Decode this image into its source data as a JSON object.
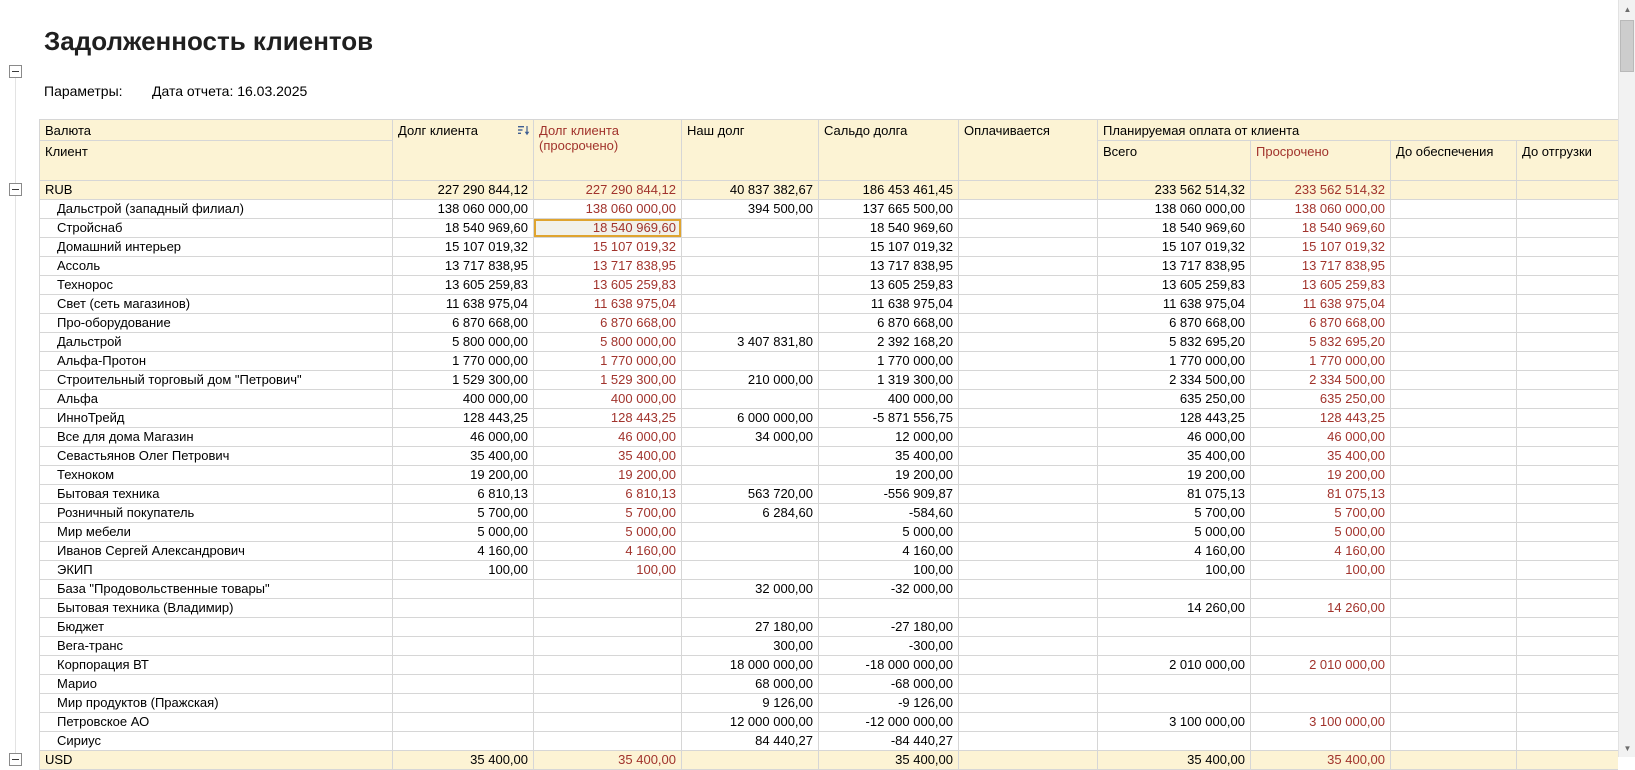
{
  "report": {
    "title": "Задолженность клиентов",
    "params_label": "Параметры:",
    "params_value": "Дата отчета: 16.03.2025"
  },
  "colors": {
    "overdue_text": "#a1332c",
    "header_bg": "#fcf3d4",
    "selection_border": "#dfa42f"
  },
  "icons": {
    "sort": "sort-descending-icon",
    "collapse": "collapse-minus-icon",
    "scroll_up": "▲",
    "scroll_down": "▼"
  },
  "table": {
    "headers": {
      "currency": "Валюта",
      "client": "Клиент",
      "client_debt": "Долг клиента",
      "client_debt_overdue": "Долг клиента (просрочено)",
      "our_debt": "Наш долг",
      "debt_balance": "Сальдо долга",
      "being_paid": "Оплачивается",
      "planned_payment": "Планируемая оплата от клиента",
      "total": "Всего",
      "overdue": "Просрочено",
      "before_security": "До обеспечения",
      "before_shipment": "До отгрузки"
    },
    "rows": [
      {
        "name": "RUB",
        "group": true,
        "cells": [
          "227 290 844,12",
          "227 290 844,12",
          "40 837 382,67",
          "186 453 461,45",
          "",
          "233 562 514,32",
          "233 562 514,32",
          "",
          ""
        ]
      },
      {
        "name": "Дальстрой (западный филиал)",
        "cells": [
          "138 060 000,00",
          "138 060 000,00",
          "394 500,00",
          "137 665 500,00",
          "",
          "138 060 000,00",
          "138 060 000,00",
          "",
          ""
        ]
      },
      {
        "name": "Стройснаб",
        "selected_cell": 1,
        "cells": [
          "18 540 969,60",
          "18 540 969,60",
          "",
          "18 540 969,60",
          "",
          "18 540 969,60",
          "18 540 969,60",
          "",
          ""
        ]
      },
      {
        "name": "Домашний интерьер",
        "cells": [
          "15 107 019,32",
          "15 107 019,32",
          "",
          "15 107 019,32",
          "",
          "15 107 019,32",
          "15 107 019,32",
          "",
          ""
        ]
      },
      {
        "name": "Ассоль",
        "cells": [
          "13 717 838,95",
          "13 717 838,95",
          "",
          "13 717 838,95",
          "",
          "13 717 838,95",
          "13 717 838,95",
          "",
          ""
        ]
      },
      {
        "name": "Технорос",
        "cells": [
          "13 605 259,83",
          "13 605 259,83",
          "",
          "13 605 259,83",
          "",
          "13 605 259,83",
          "13 605 259,83",
          "",
          ""
        ]
      },
      {
        "name": "Свет (сеть магазинов)",
        "cells": [
          "11 638 975,04",
          "11 638 975,04",
          "",
          "11 638 975,04",
          "",
          "11 638 975,04",
          "11 638 975,04",
          "",
          ""
        ]
      },
      {
        "name": "Про-оборудование",
        "cells": [
          "6 870 668,00",
          "6 870 668,00",
          "",
          "6 870 668,00",
          "",
          "6 870 668,00",
          "6 870 668,00",
          "",
          ""
        ]
      },
      {
        "name": "Дальстрой",
        "cells": [
          "5 800 000,00",
          "5 800 000,00",
          "3 407 831,80",
          "2 392 168,20",
          "",
          "5 832 695,20",
          "5 832 695,20",
          "",
          ""
        ]
      },
      {
        "name": "Альфа-Протон",
        "cells": [
          "1 770 000,00",
          "1 770 000,00",
          "",
          "1 770 000,00",
          "",
          "1 770 000,00",
          "1 770 000,00",
          "",
          ""
        ]
      },
      {
        "name": "Строительный торговый дом \"Петрович\"",
        "cells": [
          "1 529 300,00",
          "1 529 300,00",
          "210 000,00",
          "1 319 300,00",
          "",
          "2 334 500,00",
          "2 334 500,00",
          "",
          ""
        ]
      },
      {
        "name": "Альфа",
        "cells": [
          "400 000,00",
          "400 000,00",
          "",
          "400 000,00",
          "",
          "635 250,00",
          "635 250,00",
          "",
          ""
        ]
      },
      {
        "name": "ИнноТрейд",
        "cells": [
          "128 443,25",
          "128 443,25",
          "6 000 000,00",
          "-5 871 556,75",
          "",
          "128 443,25",
          "128 443,25",
          "",
          ""
        ]
      },
      {
        "name": "Все для дома Магазин",
        "cells": [
          "46 000,00",
          "46 000,00",
          "34 000,00",
          "12 000,00",
          "",
          "46 000,00",
          "46 000,00",
          "",
          ""
        ]
      },
      {
        "name": "Севастьянов Олег Петрович",
        "cells": [
          "35 400,00",
          "35 400,00",
          "",
          "35 400,00",
          "",
          "35 400,00",
          "35 400,00",
          "",
          ""
        ]
      },
      {
        "name": "Техноком",
        "cells": [
          "19 200,00",
          "19 200,00",
          "",
          "19 200,00",
          "",
          "19 200,00",
          "19 200,00",
          "",
          ""
        ]
      },
      {
        "name": "Бытовая техника",
        "cells": [
          "6 810,13",
          "6 810,13",
          "563 720,00",
          "-556 909,87",
          "",
          "81 075,13",
          "81 075,13",
          "",
          ""
        ]
      },
      {
        "name": "Розничный покупатель",
        "cells": [
          "5 700,00",
          "5 700,00",
          "6 284,60",
          "-584,60",
          "",
          "5 700,00",
          "5 700,00",
          "",
          ""
        ]
      },
      {
        "name": "Мир мебели",
        "cells": [
          "5 000,00",
          "5 000,00",
          "",
          "5 000,00",
          "",
          "5 000,00",
          "5 000,00",
          "",
          ""
        ]
      },
      {
        "name": "Иванов Сергей Александрович",
        "cells": [
          "4 160,00",
          "4 160,00",
          "",
          "4 160,00",
          "",
          "4 160,00",
          "4 160,00",
          "",
          ""
        ]
      },
      {
        "name": "ЭКИП",
        "cells": [
          "100,00",
          "100,00",
          "",
          "100,00",
          "",
          "100,00",
          "100,00",
          "",
          ""
        ]
      },
      {
        "name": "База \"Продовольственные товары\"",
        "cells": [
          "",
          "",
          "32 000,00",
          "-32 000,00",
          "",
          "",
          "",
          "",
          ""
        ]
      },
      {
        "name": "Бытовая техника (Владимир)",
        "cells": [
          "",
          "",
          "",
          "",
          "",
          "14 260,00",
          "14 260,00",
          "",
          ""
        ]
      },
      {
        "name": "Бюджет",
        "cells": [
          "",
          "",
          "27 180,00",
          "-27 180,00",
          "",
          "",
          "",
          "",
          ""
        ]
      },
      {
        "name": "Вега-транс",
        "cells": [
          "",
          "",
          "300,00",
          "-300,00",
          "",
          "",
          "",
          "",
          ""
        ]
      },
      {
        "name": "Корпорация ВТ",
        "cells": [
          "",
          "",
          "18 000 000,00",
          "-18 000 000,00",
          "",
          "2 010 000,00",
          "2 010 000,00",
          "",
          ""
        ]
      },
      {
        "name": "Марио",
        "cells": [
          "",
          "",
          "68 000,00",
          "-68 000,00",
          "",
          "",
          "",
          "",
          ""
        ]
      },
      {
        "name": "Мир продуктов (Пражская)",
        "cells": [
          "",
          "",
          "9 126,00",
          "-9 126,00",
          "",
          "",
          "",
          "",
          ""
        ]
      },
      {
        "name": "Петровское АО",
        "cells": [
          "",
          "",
          "12 000 000,00",
          "-12 000 000,00",
          "",
          "3 100 000,00",
          "3 100 000,00",
          "",
          ""
        ]
      },
      {
        "name": "Сириус",
        "cells": [
          "",
          "",
          "84 440,27",
          "-84 440,27",
          "",
          "",
          "",
          "",
          ""
        ]
      },
      {
        "name": "USD",
        "group": true,
        "cells": [
          "35 400,00",
          "35 400,00",
          "",
          "35 400,00",
          "",
          "35 400,00",
          "35 400,00",
          "",
          ""
        ]
      }
    ]
  }
}
